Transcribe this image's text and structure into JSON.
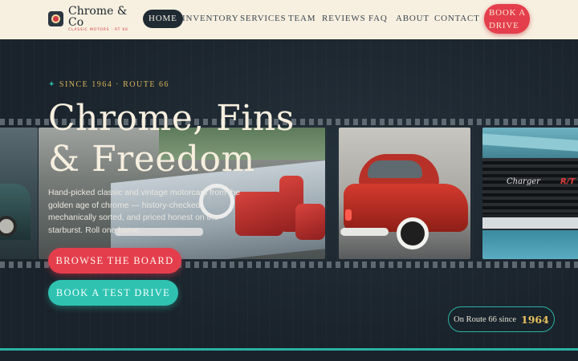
{
  "brand": {
    "name": "Chrome & Co",
    "tagline": "CLASSIC MOTORS · RT 66"
  },
  "nav": {
    "items": [
      {
        "label": "HOME",
        "active": true
      },
      {
        "label": "INVENTORY",
        "active": false
      },
      {
        "label": "SERVICES",
        "active": false
      },
      {
        "label": "TEAM",
        "active": false
      },
      {
        "label": "REVIEWS",
        "active": false
      },
      {
        "label": "FAQ",
        "active": false
      },
      {
        "label": "ABOUT",
        "active": false
      },
      {
        "label": "CONTACT",
        "active": false
      }
    ],
    "cta_label": "BOOK A DRIVE"
  },
  "hero": {
    "eyebrow": "SINCE 1964 · ROUTE 66",
    "eyebrow_icon": "sparkle-icon",
    "headline_line1": "Chrome, Fins",
    "headline_line2": "& Freedom",
    "lede": "Hand-picked classic and vintage motorcars from the golden age of chrome — history-checked, mechanically sorted, and priced honest on the starburst. Roll one home.",
    "primary_button": "BROWSE THE BOARD",
    "secondary_button": "BOOK A TEST DRIVE",
    "badge_text": "On Route 66 since",
    "badge_year": "1964"
  },
  "gallery": {
    "charger_script": "Charger",
    "charger_badge": "R/T"
  },
  "colors": {
    "nav_bg": "#f7f0e0",
    "page_bg": "#1a232b",
    "accent_red": "#e43e4d",
    "accent_teal": "#2fc2b1",
    "accent_gold": "#d8b45a"
  }
}
